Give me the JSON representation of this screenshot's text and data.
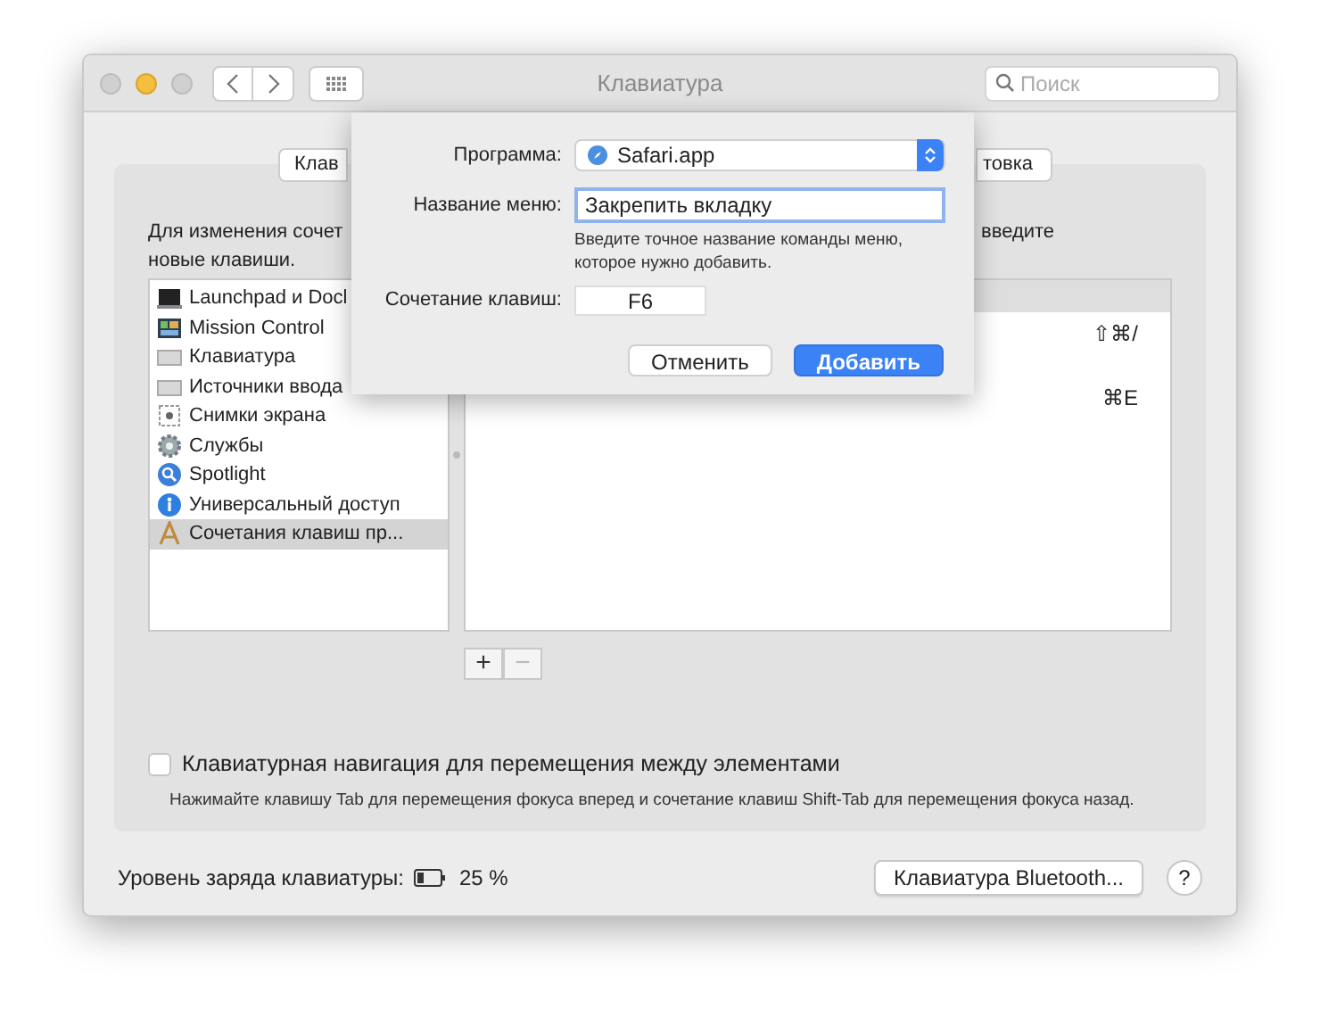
{
  "window": {
    "title": "Клавиатура",
    "search": {
      "placeholder": "Поиск"
    }
  },
  "tabs": [
    {
      "label": "Клав",
      "selected": false
    },
    {
      "label": "товка",
      "selected": false
    }
  ],
  "description": {
    "line1_left": "Для изменения сочет",
    "line1_right": "введите",
    "line2": "новые клавиши."
  },
  "categories": [
    {
      "label": "Launchpad и Docl",
      "kind": "launchpad",
      "selected": false
    },
    {
      "label": "Mission Control",
      "kind": "mission",
      "selected": false
    },
    {
      "label": "Клавиатура",
      "kind": "keyboard",
      "selected": false
    },
    {
      "label": "Источники ввода",
      "kind": "keyboard",
      "selected": false
    },
    {
      "label": "Снимки экрана",
      "kind": "screenshot",
      "selected": false
    },
    {
      "label": "Службы",
      "kind": "gear",
      "selected": false
    },
    {
      "label": "Spotlight",
      "kind": "spotlight",
      "selected": false
    },
    {
      "label": "Универсальный доступ",
      "kind": "accessibility",
      "selected": false
    },
    {
      "label": "Сочетания клавиш пр...",
      "kind": "appstore",
      "selected": true
    }
  ],
  "shortcuts": [
    {
      "keys": "⇧⌘/"
    },
    {
      "keys": "⌘E"
    }
  ],
  "list_buttons": [
    {
      "label": "+",
      "disabled": false
    },
    {
      "label": "−",
      "disabled": true
    }
  ],
  "keyboard_navigation": {
    "label": "Клавиатурная навигация для перемещения между элементами",
    "checked": false,
    "hint": "Нажимайте клавишу Tab для перемещения фокуса вперед и сочетание клавиш Shift-Tab для перемещения фокуса назад."
  },
  "battery": {
    "label": "Уровень заряда клавиатуры:",
    "reading": "25 %"
  },
  "bluetooth_button": "Клавиатура Bluetooth...",
  "help_button": "?",
  "sheet": {
    "program_label": "Программа:",
    "program_value": "Safari.app",
    "menu_label": "Название меню:",
    "menu_value": "Закрепить вкладку",
    "menu_hint": "Введите точное название команды меню, которое нужно добавить.",
    "shortcut_label": "Сочетание клавиш:",
    "shortcut_value": "F6",
    "buttons": [
      {
        "label": "Отменить",
        "default": false
      },
      {
        "label": "Добавить",
        "default": true
      }
    ]
  }
}
